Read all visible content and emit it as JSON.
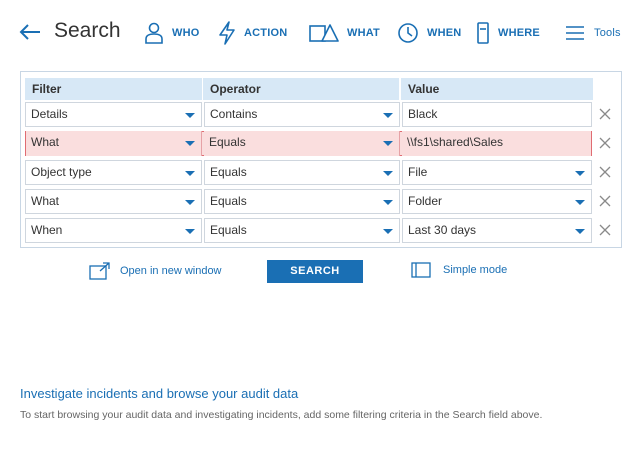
{
  "header": {
    "title": "Search",
    "nav": [
      {
        "label": "WHO",
        "icon": "person-icon"
      },
      {
        "label": "ACTION",
        "icon": "lightning-icon"
      },
      {
        "label": "WHAT",
        "icon": "shapes-icon"
      },
      {
        "label": "WHEN",
        "icon": "clock-icon"
      },
      {
        "label": "WHERE",
        "icon": "server-icon"
      }
    ],
    "tools_label": "Tools"
  },
  "filters": {
    "columns": [
      "Filter",
      "Operator",
      "Value"
    ],
    "rows": [
      {
        "filter": "Details",
        "operator": "Contains",
        "value": "Black",
        "value_dropdown": false,
        "error": false
      },
      {
        "filter": "What",
        "operator": "Equals",
        "value": "\\\\fs1\\shared\\Sales",
        "value_dropdown": false,
        "error": true
      },
      {
        "filter": "Object type",
        "operator": "Equals",
        "value": "File",
        "value_dropdown": true,
        "error": false
      },
      {
        "filter": "What",
        "operator": "Equals",
        "value": "Folder",
        "value_dropdown": true,
        "error": false
      },
      {
        "filter": "When",
        "operator": "Equals",
        "value": "Last 30 days",
        "value_dropdown": true,
        "error": false
      }
    ]
  },
  "actions": {
    "open_new_window": "Open in new window",
    "search": "SEARCH",
    "simple_mode": "Simple mode"
  },
  "info": {
    "title": "Investigate incidents and browse your audit data",
    "text": "To start browsing your audit data and investigating incidents, add some filtering criteria in the Search field above."
  },
  "colors": {
    "accent": "#1a6fb4",
    "header_bg": "#d7e8f6",
    "error_bg": "#fadede",
    "error_border": "#e06c72"
  }
}
